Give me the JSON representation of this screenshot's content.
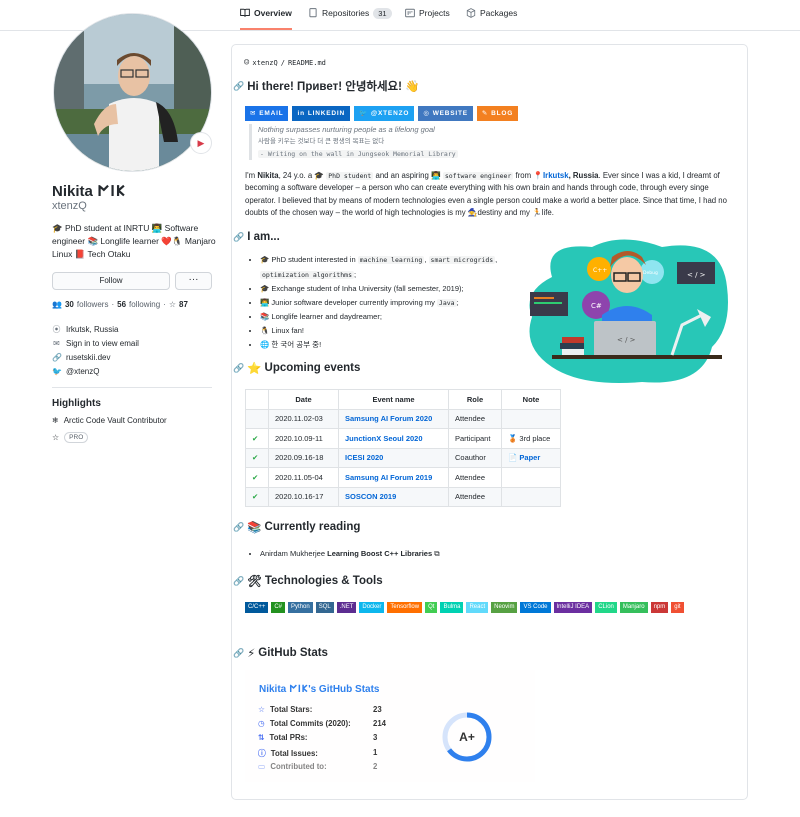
{
  "nav": {
    "tabs": [
      {
        "label": "Overview",
        "icon": "book-icon"
      },
      {
        "label": "Repositories",
        "count": "31",
        "icon": "repo-icon"
      },
      {
        "label": "Projects",
        "icon": "project-icon"
      },
      {
        "label": "Packages",
        "icon": "package-icon"
      }
    ]
  },
  "profile": {
    "name": "Nikita 𐌍𐌉𐌊",
    "login": "xtenzQ",
    "bio": "🎓 PhD student at INRTU 👨‍💻 Software engineer 📚 Longlife learner ❤️🐧 Manjaro Linux 📕 Tech Otaku",
    "follow_label": "Follow",
    "more_label": "···",
    "followers": "30",
    "followers_label": "followers",
    "following": "56",
    "following_label": "following",
    "stars": "87",
    "location": "Irkutsk, Russia",
    "email": "Sign in to view email",
    "website": "rusetskii.dev",
    "twitter": "@xtenzQ"
  },
  "highlights": {
    "title": "Highlights",
    "items": [
      "Arctic Code Vault Contributor",
      "PRO"
    ]
  },
  "readme": {
    "path_user": "xtenzQ",
    "path_sep": "/",
    "path_file": "README.md",
    "heading": "Hi there! Привет! 안녕하세요! 👋",
    "badges": [
      {
        "label": "EMAIL",
        "color": "#1a73e8"
      },
      {
        "label": "LINKEDIN",
        "color": "#0a66c2"
      },
      {
        "label": "@XTENZO",
        "color": "#1da1f2"
      },
      {
        "label": "WEBSITE",
        "color": "#4078c0"
      },
      {
        "label": "BLOG",
        "color": "#f38020"
      }
    ],
    "quote_line1": "Nothing surpasses nurturing people as a lifelong goal",
    "quote_line2": "사람을 키우는 것보다 더 큰 평생의 목표는 없다",
    "quote_line3": "- Writing on the wall in Jungseok Memorial Library",
    "intro_pre": "I'm ",
    "intro_name": "Nikita",
    "intro_mid": ", 24 y.o. a 🎓 ",
    "intro_code1": "PhD student",
    "intro_mid2": " and an aspiring 👨‍💻 ",
    "intro_code2": "software engineer",
    "intro_from": " from 📍",
    "intro_city": "Irkutsk",
    "intro_country": ", Russia",
    "intro_rest": ". Ever since I was a kid, I dreamt of becoming a software developer – a person who can create everything with his own brain and hands through code, through every singe operator. I believed that by means of modern technologies even a single person could make a world a better place. Since that time, I had no doubts of the chosen way – the world of high technologies is my 🧙destiny and my 🏃life.",
    "iam_heading": "I am...",
    "iam": [
      {
        "a": "🎓 PhD student interested in ",
        "codes": [
          "machine learning",
          "smart microgrids",
          "optimization algorithms"
        ],
        "seps": [
          ", ",
          ", ",
          ";"
        ]
      },
      {
        "a": "🎓 Exchange student of Inha University (fall semester, 2019);"
      },
      {
        "a": "👨‍💻 Junior software developer currently improving my ",
        "codes": [
          "Java"
        ],
        "seps": [
          ";"
        ]
      },
      {
        "a": "📚 Longlife learner and daydreamer;"
      },
      {
        "a": "🐧 Linux fan!"
      },
      {
        "a": "🌐 한 국어 공부 중!"
      }
    ],
    "events_heading": "Upcoming events",
    "events_headers": [
      "",
      "Date",
      "Event name",
      "Role",
      "Note"
    ],
    "events": [
      {
        "done": "",
        "date": "2020.11.02-03",
        "name": "Samsung AI Forum 2020",
        "role": "Attendee",
        "note": ""
      },
      {
        "done": "✔",
        "date": "2020.10.09-11",
        "name": "JunctionX Seoul 2020",
        "role": "Participant",
        "note": "🥉 3rd place"
      },
      {
        "done": "✔",
        "date": "2020.09.16-18",
        "name": "ICESI 2020",
        "role": "Coauthor",
        "note": "📄 Paper"
      },
      {
        "done": "✔",
        "date": "2020.11.05-04",
        "name": "Samsung AI Forum 2019",
        "role": "Attendee",
        "note": ""
      },
      {
        "done": "✔",
        "date": "2020.10.16-17",
        "name": "SOSCON 2019",
        "role": "Attendee",
        "note": ""
      }
    ],
    "reading_heading": "Currently reading",
    "reading_author": "Anirdam Mukherjee ",
    "reading_title": "Learning Boost C++ Libraries",
    "tech_heading": "Technologies & Tools",
    "tech": [
      {
        "label": "C/C++",
        "color": "#00599c"
      },
      {
        "label": "C#",
        "color": "#239120"
      },
      {
        "label": "Python",
        "color": "#3670a0"
      },
      {
        "label": "SQL",
        "color": "#336791"
      },
      {
        "label": ".NET",
        "color": "#5c2d91"
      },
      {
        "label": "Docker",
        "color": "#0db7ed"
      },
      {
        "label": "Tensorflow",
        "color": "#ff6f00"
      },
      {
        "label": "Qt",
        "color": "#41cd52"
      },
      {
        "label": "Bulma",
        "color": "#00d1b2"
      },
      {
        "label": "React",
        "color": "#61dafb"
      },
      {
        "label": "Neovim",
        "color": "#57a143"
      },
      {
        "label": "VS Code",
        "color": "#0078d7"
      },
      {
        "label": "IntelliJ IDEA",
        "color": "#6b2fa0"
      },
      {
        "label": "CLion",
        "color": "#21d789"
      },
      {
        "label": "Manjaro",
        "color": "#35bf5c"
      },
      {
        "label": "npm",
        "color": "#cb3837"
      },
      {
        "label": "git",
        "color": "#f05033"
      }
    ],
    "gh_heading": "GitHub Stats",
    "gh_title": "Nikita 𐌍𐌉𐌊's GitHub Stats",
    "gh_rows": [
      {
        "label": "Total Stars:",
        "value": "23",
        "icon": "star-icon"
      },
      {
        "label": "Total Commits (2020):",
        "value": "214",
        "icon": "history-icon"
      },
      {
        "label": "Total PRs:",
        "value": "3",
        "icon": "pr-icon"
      },
      {
        "label": "Total Issues:",
        "value": "1",
        "icon": "issue-icon"
      },
      {
        "label": "Contributed to:",
        "value": "2",
        "icon": "repo-icon"
      }
    ],
    "gh_grade": "A+",
    "gh_grade_progress": 0.65
  }
}
